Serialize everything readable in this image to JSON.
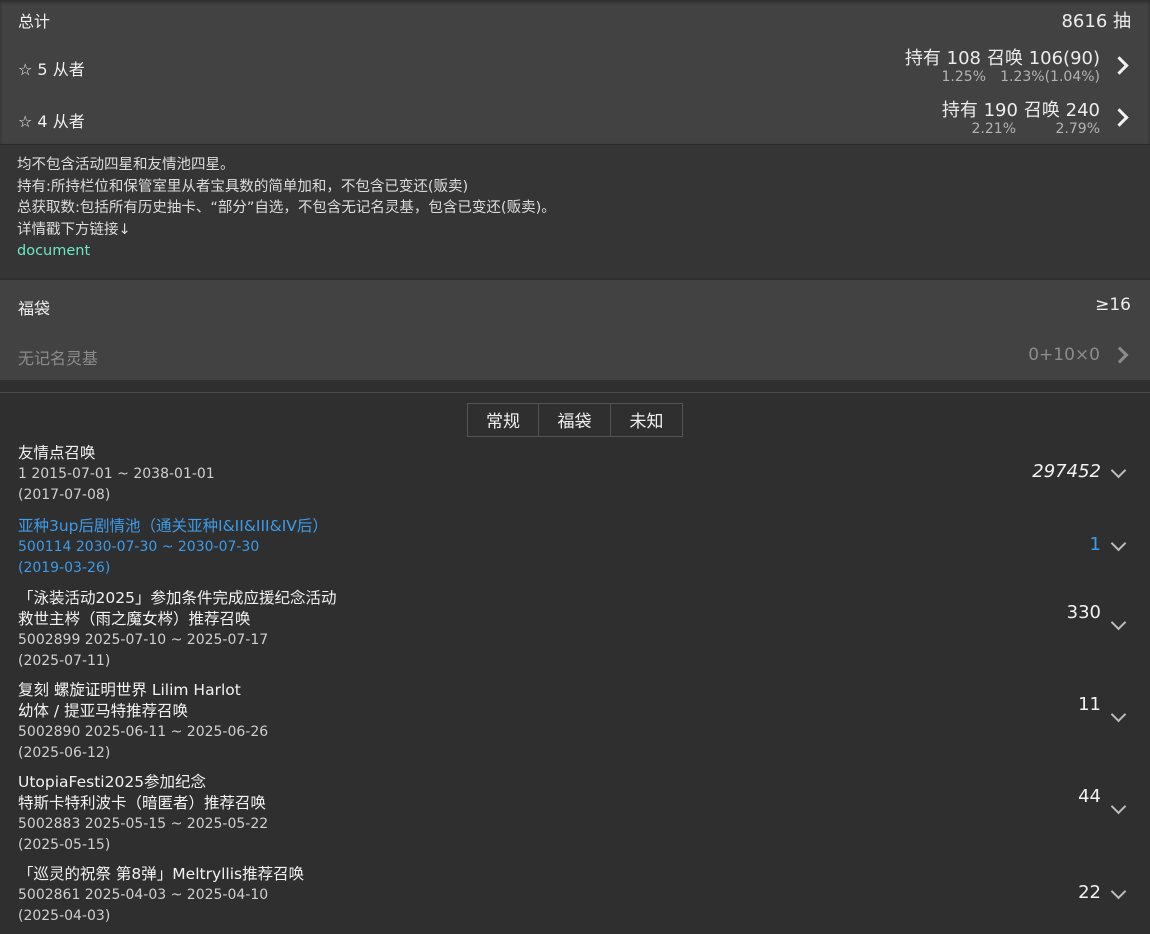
{
  "summary": {
    "total_label": "总计",
    "total_value": "8616 抽",
    "star5": {
      "label": "☆ 5 从者",
      "held": "持有 108",
      "summoned": "召唤 106(90)",
      "held_pct": "1.25%",
      "summoned_pct": "1.23%(1.04%)"
    },
    "star4": {
      "label": "☆ 4 从者",
      "held": "持有 190",
      "summoned": "召唤 240",
      "held_pct": "2.21%",
      "summoned_pct": "2.79%"
    }
  },
  "notes": {
    "line1": "均不包含活动四星和友情池四星。",
    "line2": "持有:所持栏位和保管室里从者宝具数的简单加和，不包含已变还(贩卖)",
    "line3": "总获取数:包括所有历史抽卡、“部分”自选，不包含无记名灵基，包含已变还(贩卖)。",
    "line4": "详情戳下方链接↓",
    "link": "document"
  },
  "lucky": {
    "bag_label": "福袋",
    "bag_value": "≥16",
    "unnamed_label": "无记名灵基",
    "unnamed_value": "0+10×0"
  },
  "tabs": [
    "常规",
    "福袋",
    "未知"
  ],
  "items": [
    {
      "lines": [
        "友情点召唤"
      ],
      "meta": "1   2015-07-01 ~ 2038-01-01",
      "date": "(2017-07-08)",
      "count": "297452"
    },
    {
      "lines": [
        "亚种3up后剧情池（通关亚种I&II&III&IV后）"
      ],
      "meta": "500114   2030-07-30 ~ 2030-07-30",
      "date": "(2019-03-26)",
      "count": "1"
    },
    {
      "lines": [
        "「泳装活动2025」参加条件完成应援纪念活动",
        "救世主梣（雨之魔女梣）推荐召唤"
      ],
      "meta": "5002899   2025-07-10 ~ 2025-07-17",
      "date": "(2025-07-11)",
      "count": "330"
    },
    {
      "lines": [
        "复刻 螺旋证明世界 Lilim Harlot",
        "幼体 / 提亚马特推荐召唤"
      ],
      "meta": "5002890   2025-06-11 ~ 2025-06-26",
      "date": "(2025-06-12)",
      "count": "11"
    },
    {
      "lines": [
        "UtopiaFesti2025参加纪念",
        "特斯卡特利波卡（暗匿者）推荐召唤"
      ],
      "meta": "5002883   2025-05-15 ~ 2025-05-22",
      "date": "(2025-05-15)",
      "count": "44"
    },
    {
      "lines": [
        "「巡灵的祝祭 第8弹」Meltryllis推荐召唤"
      ],
      "meta": "5002861   2025-04-03 ~ 2025-04-10",
      "date": "(2025-04-03)",
      "count": "22"
    }
  ],
  "colors": {
    "link": "#6ee8c4",
    "highlight": "#3d9be9"
  },
  "icons": {
    "row_arrow": "chevron-right-icon",
    "expand": "chevron-down-icon"
  }
}
